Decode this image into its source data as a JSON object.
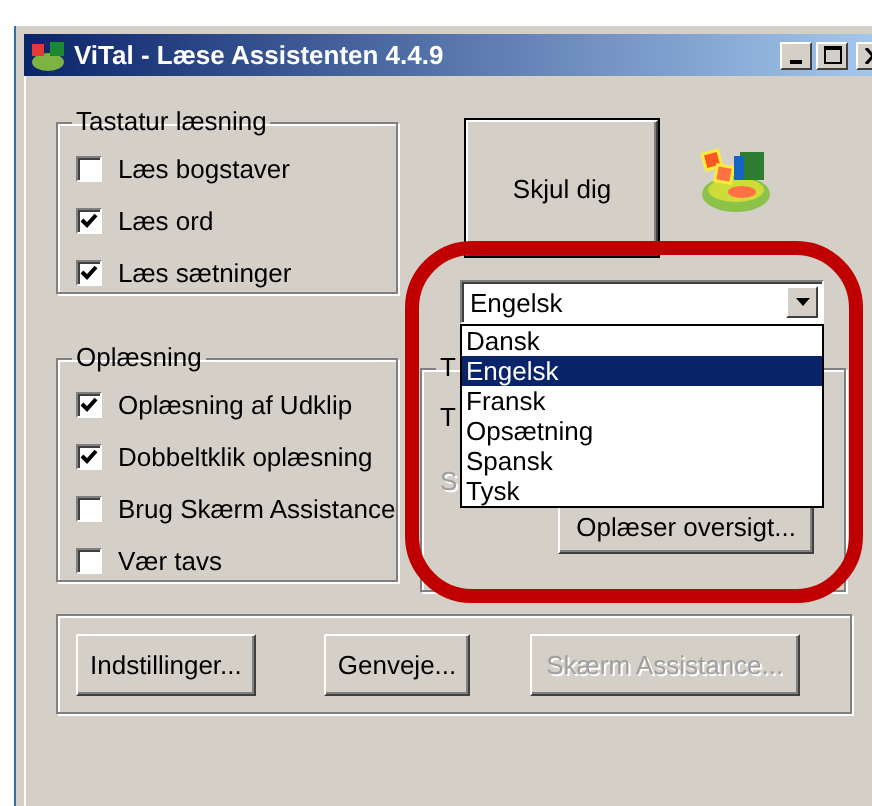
{
  "window": {
    "title": "ViTal - Læse Assistenten 4.4.9"
  },
  "keyboard_group": {
    "title": "Tastatur læsning",
    "options": [
      {
        "label": "Læs bogstaver",
        "checked": false
      },
      {
        "label": "Læs ord",
        "checked": true
      },
      {
        "label": "Læs sætninger",
        "checked": true
      }
    ]
  },
  "hide_button": "Skjul dig",
  "language_combo": {
    "value": "Engelsk",
    "expanded": true,
    "options": [
      {
        "label": "Dansk",
        "selected": false
      },
      {
        "label": "Engelsk",
        "selected": true
      },
      {
        "label": "Fransk",
        "selected": false
      },
      {
        "label": "Opsætning",
        "selected": false
      },
      {
        "label": "Spansk",
        "selected": false
      },
      {
        "label": "Tysk",
        "selected": false
      }
    ]
  },
  "reading_group": {
    "title": "Oplæsning",
    "options": [
      {
        "label": "Oplæsning af Udklip",
        "checked": true
      },
      {
        "label": "Dobbeltklik oplæsning",
        "checked": true
      },
      {
        "label": "Brug Skærm Assistance",
        "checked": false
      },
      {
        "label": "Vær tavs",
        "checked": false
      }
    ]
  },
  "voice_group": {
    "title": "T",
    "lines": [
      {
        "text": "T",
        "disabled": false
      },
      {
        "text": "S",
        "disabled": true
      }
    ],
    "button": "Oplæser oversigt..."
  },
  "bottom_buttons": [
    {
      "label": "Indstillinger...",
      "disabled": false
    },
    {
      "label": "Genveje...",
      "disabled": false
    },
    {
      "label": "Skærm Assistance...",
      "disabled": true
    }
  ]
}
